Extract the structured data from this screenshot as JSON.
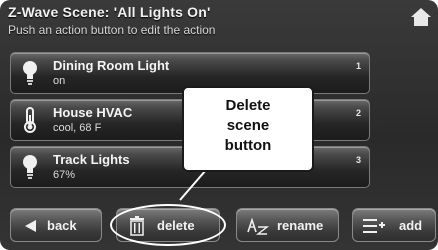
{
  "header": {
    "title": "Z-Wave Scene: 'All Lights On'",
    "subtitle": "Push an action button to edit the action",
    "home_icon": "home-icon"
  },
  "actions": [
    {
      "name": "Dining Room Light",
      "state": "on",
      "number": "1",
      "icon": "bulb-icon"
    },
    {
      "name": "House HVAC",
      "state": "cool, 68 F",
      "number": "2",
      "icon": "thermometer-icon"
    },
    {
      "name": "Track Lights",
      "state": "67%",
      "number": "3",
      "icon": "bulb-icon"
    }
  ],
  "callout": {
    "line1": "Delete",
    "line2": "scene",
    "line3": "button"
  },
  "buttons": {
    "back": "back",
    "delete": "delete",
    "rename": "rename",
    "add": "add"
  },
  "colors": {
    "screen_bg": "#2a2a2a",
    "button_face": "#565656",
    "text": "#f2f2f2",
    "callout_bg": "#ffffff"
  }
}
